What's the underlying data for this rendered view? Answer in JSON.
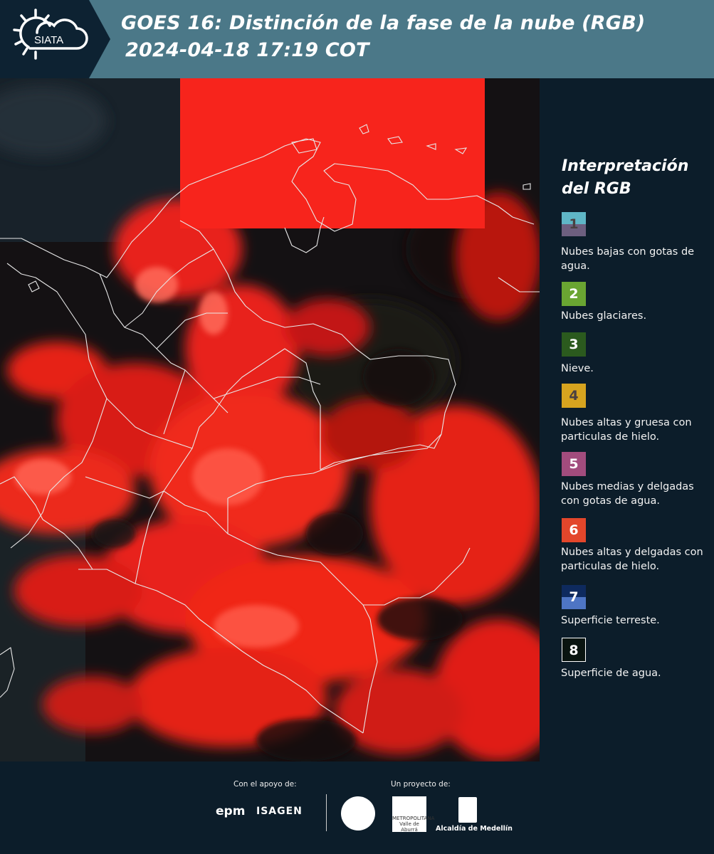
{
  "header": {
    "logo_text": "SIATA",
    "title_line1": "GOES 16: Distinción de la fase de la nube (RGB)",
    "title_line2": "2024-04-18 17:19 COT"
  },
  "legend": {
    "title_line1": "Interpretación",
    "title_line2": "del RGB",
    "items": [
      {
        "number": "1",
        "label": "Nubes bajas con gotas de agua.",
        "color_top": "#5fb6c6",
        "color_bottom": "#6d5f7f"
      },
      {
        "number": "2",
        "label": "Nubes glaciares.",
        "color_top": "#6aa532",
        "color_bottom": "#6aa532"
      },
      {
        "number": "3",
        "label": "Nieve.",
        "color_top": "#2b5a1e",
        "color_bottom": "#2b5a1e"
      },
      {
        "number": "4",
        "label": "Nubes altas y gruesa con particulas de hielo.",
        "color_top": "#d7a41f",
        "color_bottom": "#d7a41f"
      },
      {
        "number": "5",
        "label": "Nubes medias y delgadas con gotas de agua.",
        "color_top": "#a24c7d",
        "color_bottom": "#a24c7d"
      },
      {
        "number": "6",
        "label": "Nubes altas y delgadas con particulas de hielo.",
        "color_top": "#e3462b",
        "color_bottom": "#e3462b"
      },
      {
        "number": "7",
        "label": "Superficie terreste.",
        "color_top": "#0e2a5e",
        "color_bottom": "#4e75c4"
      },
      {
        "number": "8",
        "label": "Superficie de agua.",
        "color_top": "#091410",
        "color_bottom": "#091410"
      }
    ]
  },
  "footer": {
    "support_label": "Con el apoyo de:",
    "project_label": "Un proyecto de:",
    "epm": "epm",
    "isagen": "ISAGEN",
    "amva_line1": "METROPOLITANA",
    "amva_line2": "Valle de Aburrá",
    "alcaldia": "Alcaldía de Medellín"
  }
}
